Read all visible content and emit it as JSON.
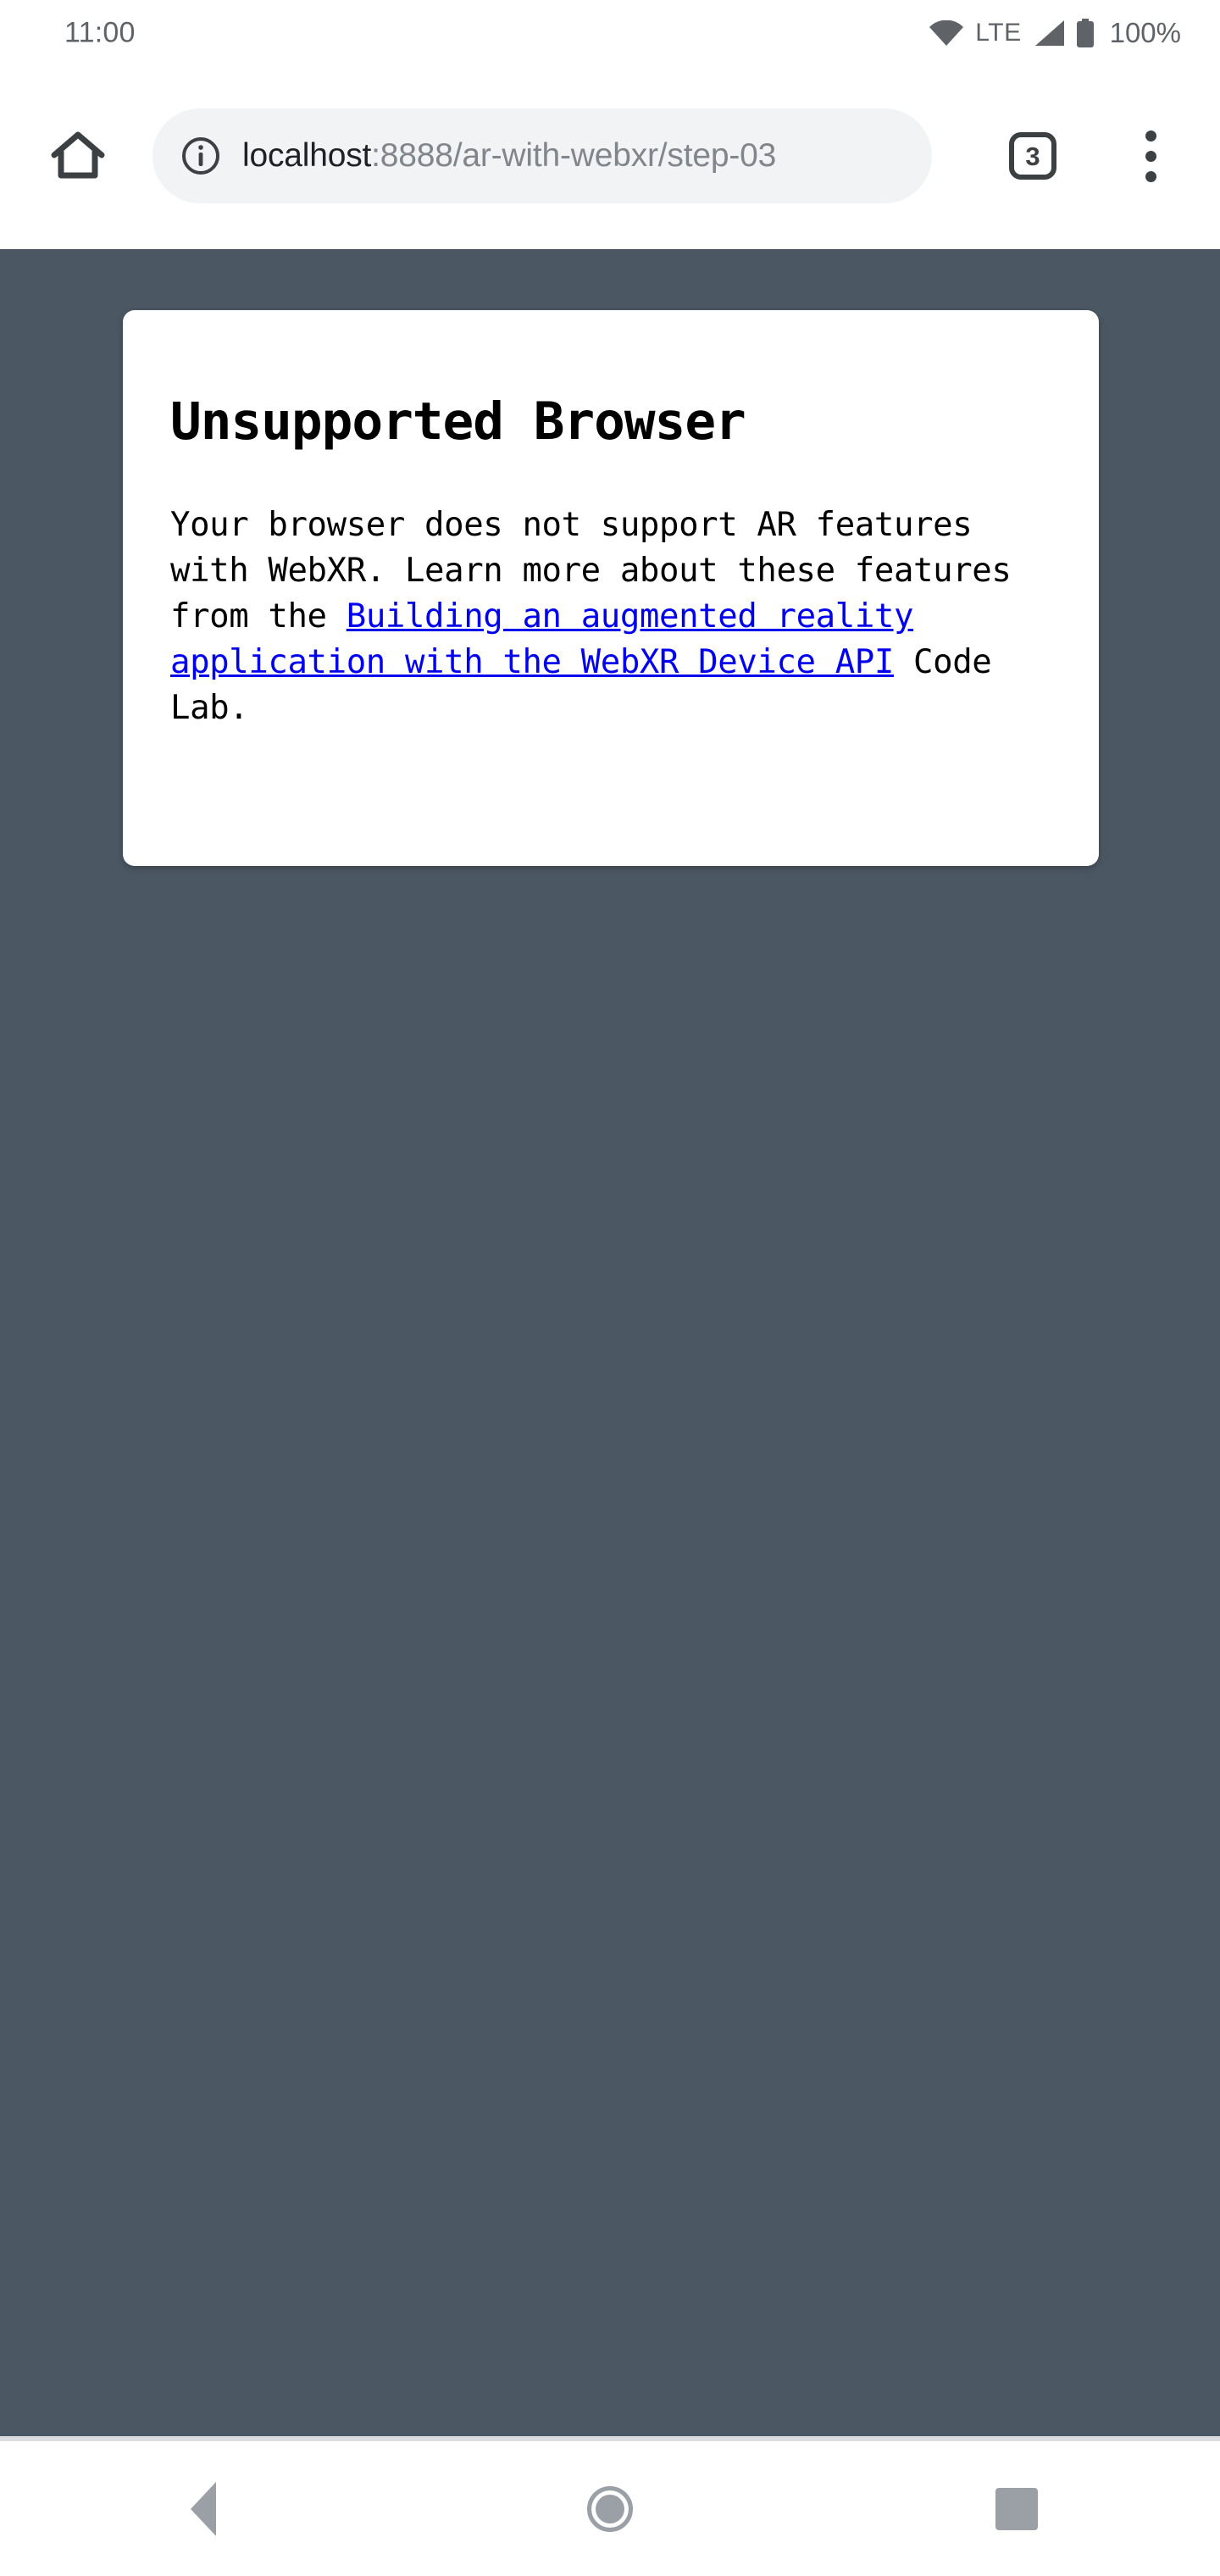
{
  "statusbar": {
    "time": "11:00",
    "network_label": "LTE",
    "battery_percent": "100%",
    "icons": [
      "wifi-icon",
      "signal-icon",
      "battery-icon"
    ]
  },
  "browser": {
    "home_icon": "home-icon",
    "security_icon": "info-icon",
    "url_host": "localhost",
    "url_rest": ":8888/ar-with-webxr/step-03",
    "url_full": "localhost:8888/ar-with-webxr/step-03",
    "tab_count": "3",
    "menu_icon": "overflow-menu-icon"
  },
  "page": {
    "background_color": "#4b5762",
    "card": {
      "title": "Unsupported Browser",
      "body_before_link": "Your browser does not support AR features with WebXR. Learn more about these features from the ",
      "link_text": "Building an augmented reality application with the WebXR Device API",
      "body_after_link": " Code Lab.",
      "link_color": "#0000ee"
    }
  },
  "navbar": {
    "back_label": "back-button",
    "home_label": "home-button",
    "recents_label": "recent-apps-button"
  }
}
